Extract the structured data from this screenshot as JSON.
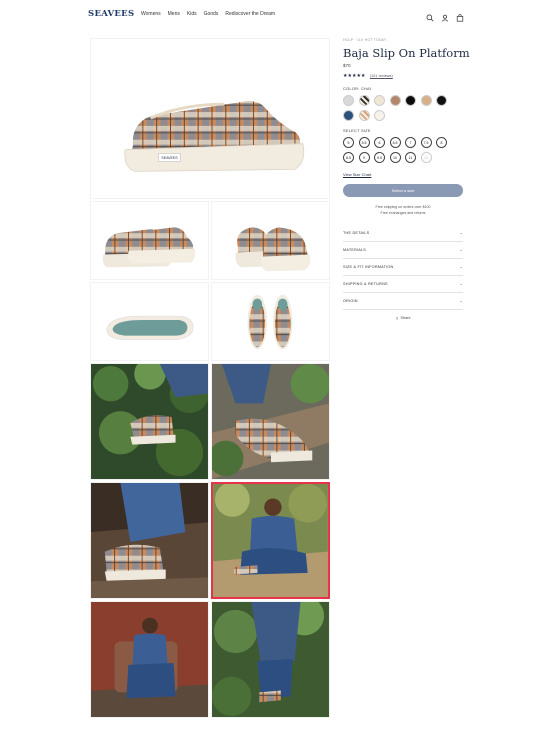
{
  "header": {
    "logo": "SEAVEES",
    "nav": [
      "Womens",
      "Mens",
      "Kids",
      "Goods",
      "Rediscover the Dream"
    ],
    "icons": [
      "search-icon",
      "account-icon",
      "cart-icon"
    ]
  },
  "product": {
    "breadcrumb": "HOLP · 11X HOT TODAY",
    "title": "Baja Slip On Platform",
    "price": "$70",
    "stars": "★★★★★",
    "reviews": "(101 reviews)",
    "color_label": "COLOR: CHAI",
    "swatch_colors": [
      "#d9d9d9",
      "#2b2b2b",
      "#efe6d4",
      "#b5876a",
      "#0d0d0d",
      "#d7b08a",
      "#111111",
      "#2c4f7c",
      "#e8b48f",
      "#f6f3ec"
    ],
    "size_label": "SELECT SIZE",
    "sizes": [
      "5",
      "5.5",
      "6",
      "6.5",
      "7",
      "7.5",
      "8",
      "8.5",
      "9",
      "9.5",
      "10",
      "11",
      "12"
    ],
    "size_chart": "View Size Chart",
    "select_button": "Select a size",
    "shipping_line1": "Free shipping on orders over $100",
    "shipping_line2": "Free exchanges and returns",
    "accordion": [
      "THE DETAILS",
      "MATERIALS",
      "SIZE & FIT INFORMATION",
      "SHIPPING & RETURNS",
      "ORIGIN"
    ],
    "share": "Share"
  },
  "colors": {
    "accent": "#1f2a44",
    "button": "#8a99b4",
    "highlight": "#e8344a"
  }
}
